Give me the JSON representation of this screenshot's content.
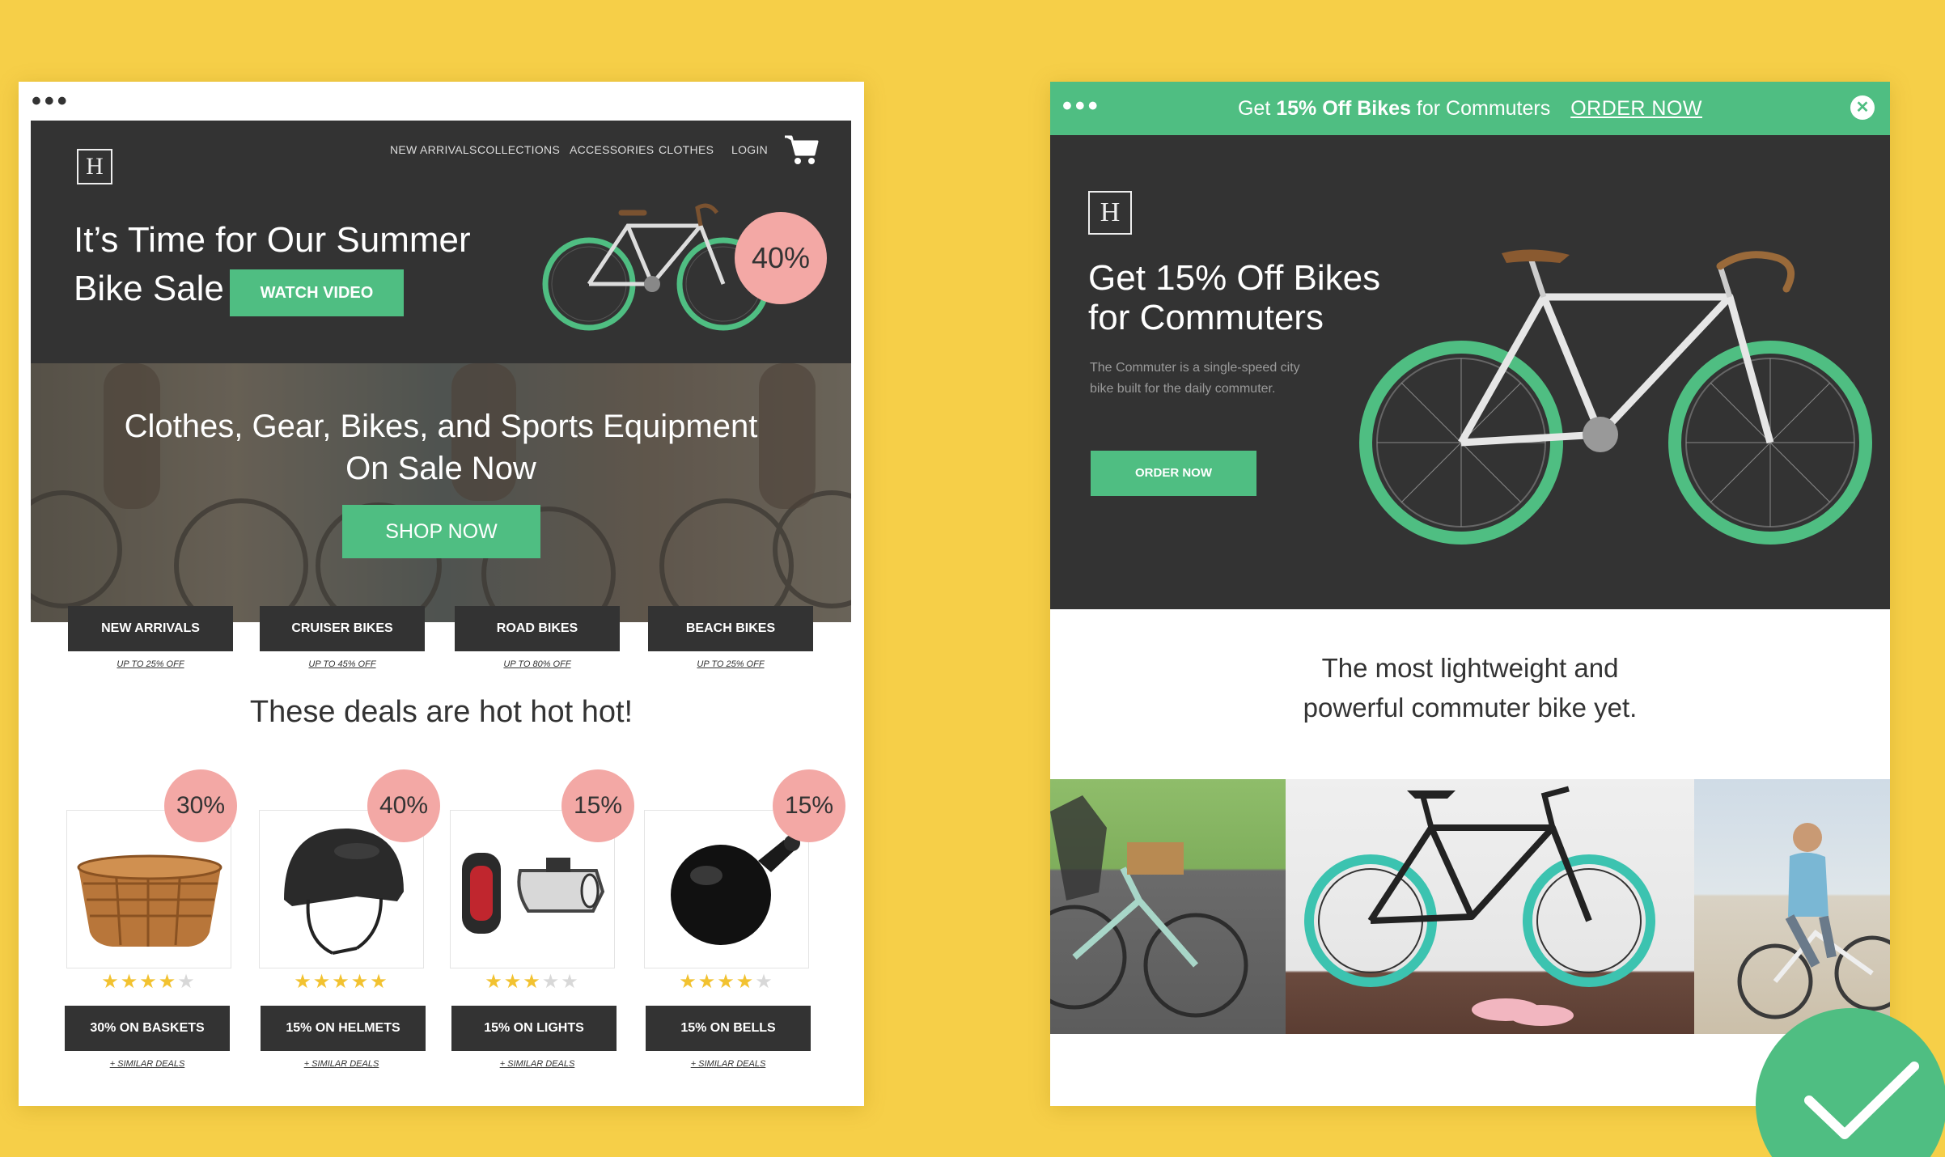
{
  "left_mockup": {
    "window_dots": "•••",
    "logo": "H",
    "nav": [
      "NEW ARRIVALS",
      "COLLECTIONS",
      "ACCESSORIES",
      "CLOTHES",
      "LOGIN"
    ],
    "hero": {
      "headline_line1": "It’s Time for Our Summer",
      "headline_line2": "Bike Sale",
      "watch_video": "WATCH VIDEO",
      "discount": "40%"
    },
    "banner": {
      "line1": "Clothes, Gear, Bikes, and Sports Equipment",
      "line2": "On Sale Now",
      "shop_now": "SHOP NOW"
    },
    "categories": [
      {
        "label": "NEW ARRIVALS",
        "sub": "UP TO 25% OFF"
      },
      {
        "label": "CRUISER BIKES",
        "sub": "UP TO 45% OFF"
      },
      {
        "label": "ROAD BIKES",
        "sub": "UP TO 80% OFF"
      },
      {
        "label": "BEACH BIKES",
        "sub": "UP TO 25% OFF"
      }
    ],
    "deals_heading": "These deals are hot hot hot!",
    "products": [
      {
        "icon": "basket-icon",
        "discount": "30%",
        "rating": 4,
        "button": "30% ON BASKETS",
        "link": "+ SIMILAR DEALS"
      },
      {
        "icon": "helmet-icon",
        "discount": "40%",
        "rating": 5,
        "button": "15% ON HELMETS",
        "link": "+ SIMILAR DEALS"
      },
      {
        "icon": "bike-light-icon",
        "discount": "15%",
        "rating": 3,
        "button": "15% ON LIGHTS",
        "link": "+ SIMILAR DEALS"
      },
      {
        "icon": "bike-bell-icon",
        "discount": "15%",
        "rating": 4,
        "button": "15% ON BELLS",
        "link": "+ SIMILAR DEALS"
      }
    ]
  },
  "right_mockup": {
    "window_dots": "•••",
    "promo_bar": {
      "prefix": "Get ",
      "bold": "15% Off Bikes",
      "suffix": " for Commuters",
      "link": "ORDER NOW"
    },
    "logo": "H",
    "hero": {
      "headline_line1": "Get 15% Off Bikes",
      "headline_line2": "for Commuters",
      "description": "The Commuter is a single-speed city bike built for the daily commuter.",
      "button": "ORDER NOW"
    },
    "tagline_line1": "The most lightweight and",
    "tagline_line2": "powerful commuter bike yet."
  },
  "colors": {
    "background": "#f6cf48",
    "accent_green": "#4fbe82",
    "dark": "#333333",
    "badge_pink": "#f3a8a5",
    "star": "#f2c230"
  }
}
